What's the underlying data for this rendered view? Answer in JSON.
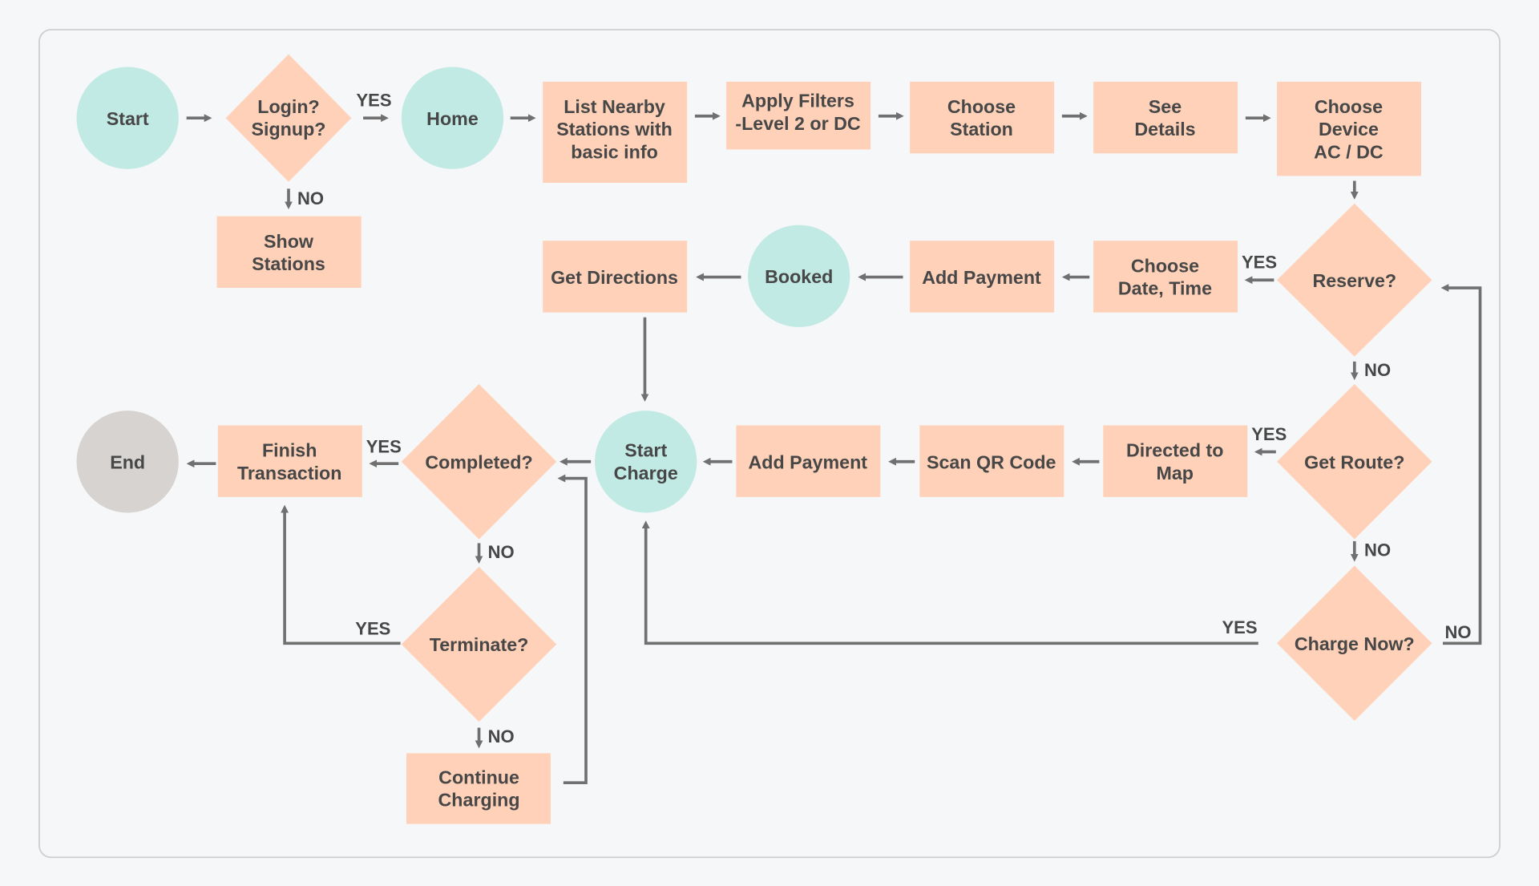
{
  "colors": {
    "terminal": "#c2eae4",
    "process": "#ffd1b8",
    "end": "#d6d3d1",
    "connector": "#707070",
    "text": "#474747",
    "background": "#f6f7f9"
  },
  "nodes": {
    "start": {
      "lines": [
        "Start"
      ]
    },
    "login": {
      "lines": [
        "Login?",
        "Signup?"
      ]
    },
    "home": {
      "lines": [
        "Home"
      ]
    },
    "list_nearby": {
      "lines": [
        "List Nearby",
        "Stations with",
        "basic info"
      ]
    },
    "apply_filters": {
      "lines": [
        "Apply Filters",
        "-Level 2 or DC"
      ]
    },
    "choose_station": {
      "lines": [
        "Choose",
        "Station"
      ]
    },
    "see_details": {
      "lines": [
        "See",
        "Details"
      ]
    },
    "choose_device": {
      "lines": [
        "Choose",
        "Device",
        "AC / DC"
      ]
    },
    "show_stations": {
      "lines": [
        "Show",
        "Stations"
      ]
    },
    "reserve": {
      "lines": [
        "Reserve?"
      ]
    },
    "choose_date": {
      "lines": [
        "Choose",
        "Date, Time"
      ]
    },
    "add_payment_1": {
      "lines": [
        "Add Payment"
      ]
    },
    "booked": {
      "lines": [
        "Booked"
      ]
    },
    "get_directions": {
      "lines": [
        "Get Directions"
      ]
    },
    "get_route": {
      "lines": [
        "Get Route?"
      ]
    },
    "directed_map": {
      "lines": [
        "Directed to",
        "Map"
      ]
    },
    "scan_qr": {
      "lines": [
        "Scan QR Code"
      ]
    },
    "add_payment_2": {
      "lines": [
        "Add Payment"
      ]
    },
    "start_charge": {
      "lines": [
        "Start",
        "Charge"
      ]
    },
    "completed": {
      "lines": [
        "Completed?"
      ]
    },
    "finish": {
      "lines": [
        "Finish",
        "Transaction"
      ]
    },
    "end": {
      "lines": [
        "End"
      ]
    },
    "terminate": {
      "lines": [
        "Terminate?"
      ]
    },
    "continue": {
      "lines": [
        "Continue",
        "Charging"
      ]
    },
    "charge_now": {
      "lines": [
        "Charge Now?"
      ]
    }
  },
  "edge_labels": {
    "login_yes": "YES",
    "login_no": "NO",
    "reserve_yes": "YES",
    "reserve_no": "NO",
    "route_yes": "YES",
    "route_no": "NO",
    "charge_yes": "YES",
    "charge_no": "NO",
    "completed_yes": "YES",
    "completed_no": "NO",
    "terminate_yes": "YES",
    "terminate_no": "NO"
  }
}
